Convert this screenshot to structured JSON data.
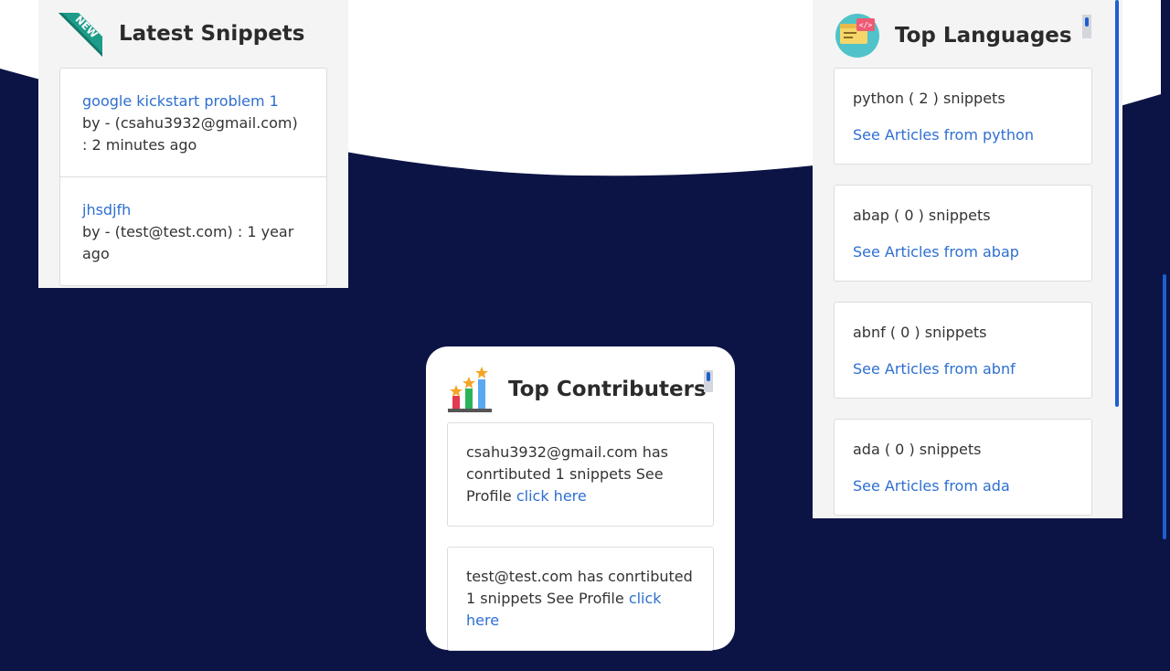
{
  "colors": {
    "background": "#0c1445",
    "accent": "#2e6fd1",
    "panel": "#f4f4f4"
  },
  "latest_snippets": {
    "title": "Latest Snippets",
    "badge_icon": "new-ribbon-icon",
    "badge_text": "NEW",
    "items": [
      {
        "title": "google kickstart problem 1",
        "meta": "by - (csahu3932@gmail.com) : 2 minutes ago"
      },
      {
        "title": "jhsdjfh",
        "meta": "by - (test@test.com) : 1 year ago"
      }
    ]
  },
  "top_languages": {
    "title": "Top Languages",
    "icon": "code-window-icon",
    "items": [
      {
        "count": "python ( 2 ) snippets",
        "link": "See Articles from python"
      },
      {
        "count": "abap ( 0 ) snippets",
        "link": "See Articles from abap"
      },
      {
        "count": "abnf ( 0 ) snippets",
        "link": "See Articles from abnf"
      },
      {
        "count": "ada ( 0 ) snippets",
        "link": "See Articles from ada"
      }
    ]
  },
  "top_contributers": {
    "title": "Top Contributers",
    "icon": "bar-chart-stars-icon",
    "items": [
      {
        "text": "csahu3932@gmail.com has conrtibuted 1 snippets See Profile",
        "link": "click here"
      },
      {
        "text": "test@test.com has conrtibuted 1 snippets See Profile",
        "link": "click here"
      }
    ]
  }
}
